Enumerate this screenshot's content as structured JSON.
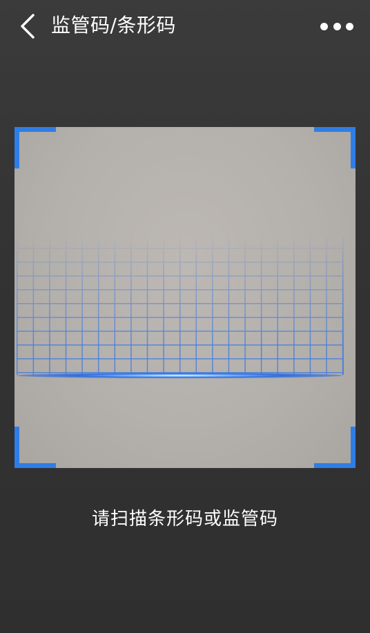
{
  "header": {
    "title": "监管码/条形码",
    "back_icon": "chevron-left-icon",
    "more_icon": "more-horizontal-icon"
  },
  "scanner": {
    "hint": "请扫描条形码或监管码",
    "accent_color": "#2f7de6"
  }
}
